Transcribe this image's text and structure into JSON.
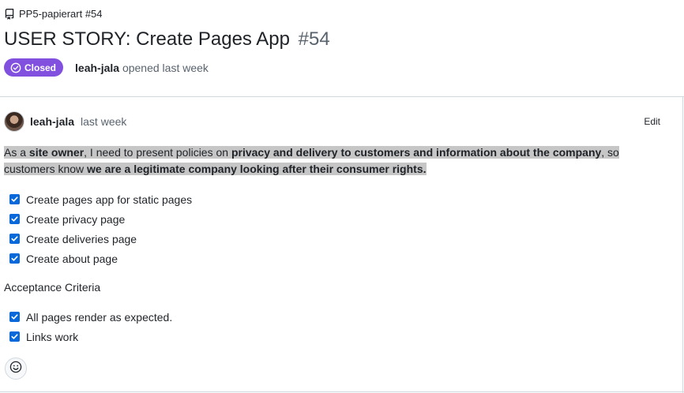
{
  "breadcrumb": {
    "repo_label": "PP5-papierart #54"
  },
  "issue": {
    "title": "USER STORY: Create Pages App",
    "number": "#54",
    "status": "Closed",
    "author": "leah-jala",
    "opened_text": "opened last week"
  },
  "comment": {
    "author": "leah-jala",
    "time": "last week",
    "edit_label": "Edit",
    "story": {
      "p1": "As a ",
      "b1": "site owner",
      "p2": ", I need to present policies on ",
      "b2": "privacy and delivery to customers and information about the company",
      "p3": ", so customers know ",
      "b3": "we are a legitimate company looking after their consumer rights."
    },
    "tasks": [
      {
        "label": "Create pages app for static pages",
        "checked": true
      },
      {
        "label": "Create privacy page",
        "checked": true
      },
      {
        "label": "Create deliveries page",
        "checked": true
      },
      {
        "label": "Create about page",
        "checked": true
      }
    ],
    "acceptance_label": "Acceptance Criteria",
    "criteria": [
      {
        "label": "All pages render as expected.",
        "checked": true
      },
      {
        "label": "Links work",
        "checked": true
      }
    ]
  },
  "icons": {
    "repo": "repo-icon",
    "closed": "check-circle-icon",
    "checkbox": "checkbox-checked-icon",
    "reaction": "smiley-icon"
  },
  "colors": {
    "closed_badge": "#8250df",
    "checkbox": "#0969da",
    "highlight": "#c6c6c6"
  }
}
